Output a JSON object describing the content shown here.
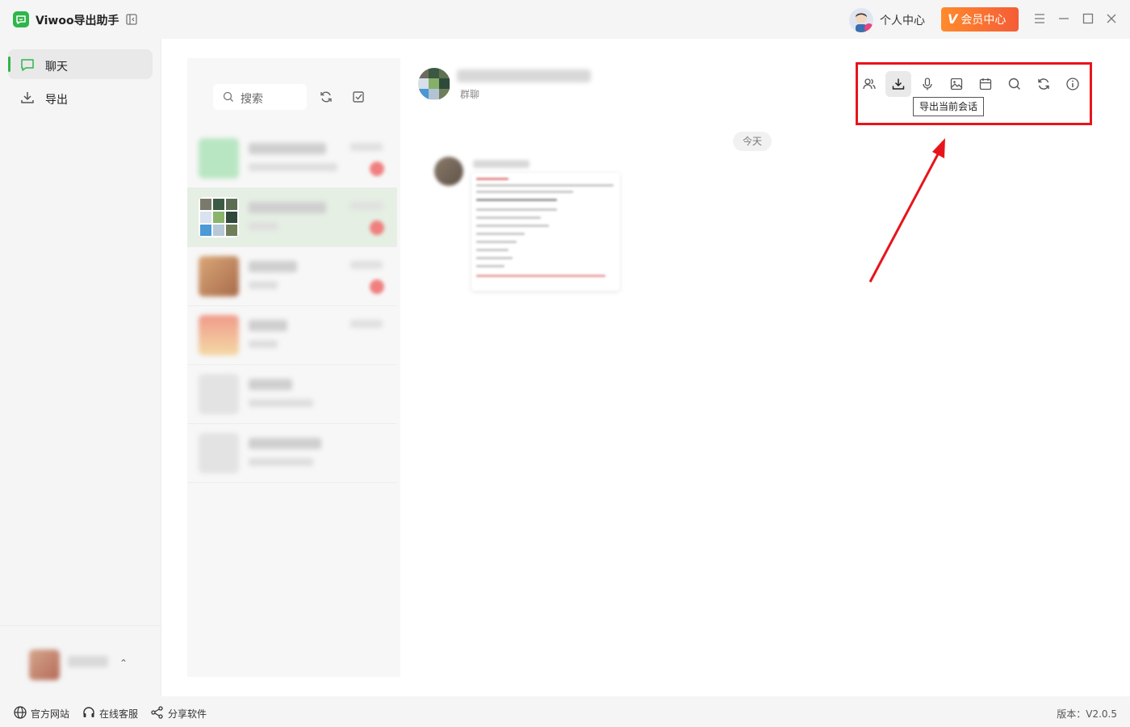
{
  "app": {
    "name": "Viwoo导出助手"
  },
  "header": {
    "user_center": "个人中心",
    "vip_label": "会员中心",
    "vip_badge": "V"
  },
  "nav": {
    "items": [
      {
        "label": "聊天",
        "icon": "chat-bubble-icon",
        "active": true
      },
      {
        "label": "导出",
        "icon": "download-icon",
        "active": false
      }
    ]
  },
  "session_list": {
    "search_placeholder": "搜索"
  },
  "conversation": {
    "subtitle": "群聊",
    "toolbar": {
      "buttons": [
        "members-icon",
        "download-icon",
        "microphone-icon",
        "image-icon",
        "calendar-icon",
        "search-icon",
        "refresh-icon",
        "info-icon"
      ],
      "active_button": "download-icon",
      "tooltip": "导出当前会话"
    },
    "date_divider": "今天"
  },
  "annotation": {
    "highlight_color": "#e8141b"
  },
  "footer": {
    "website": "官方网站",
    "support": "在线客服",
    "share": "分享软件",
    "version": "版本：V2.0.5"
  },
  "colors": {
    "brand_green": "#2fb64a",
    "vip_orange": "#f45d36"
  }
}
